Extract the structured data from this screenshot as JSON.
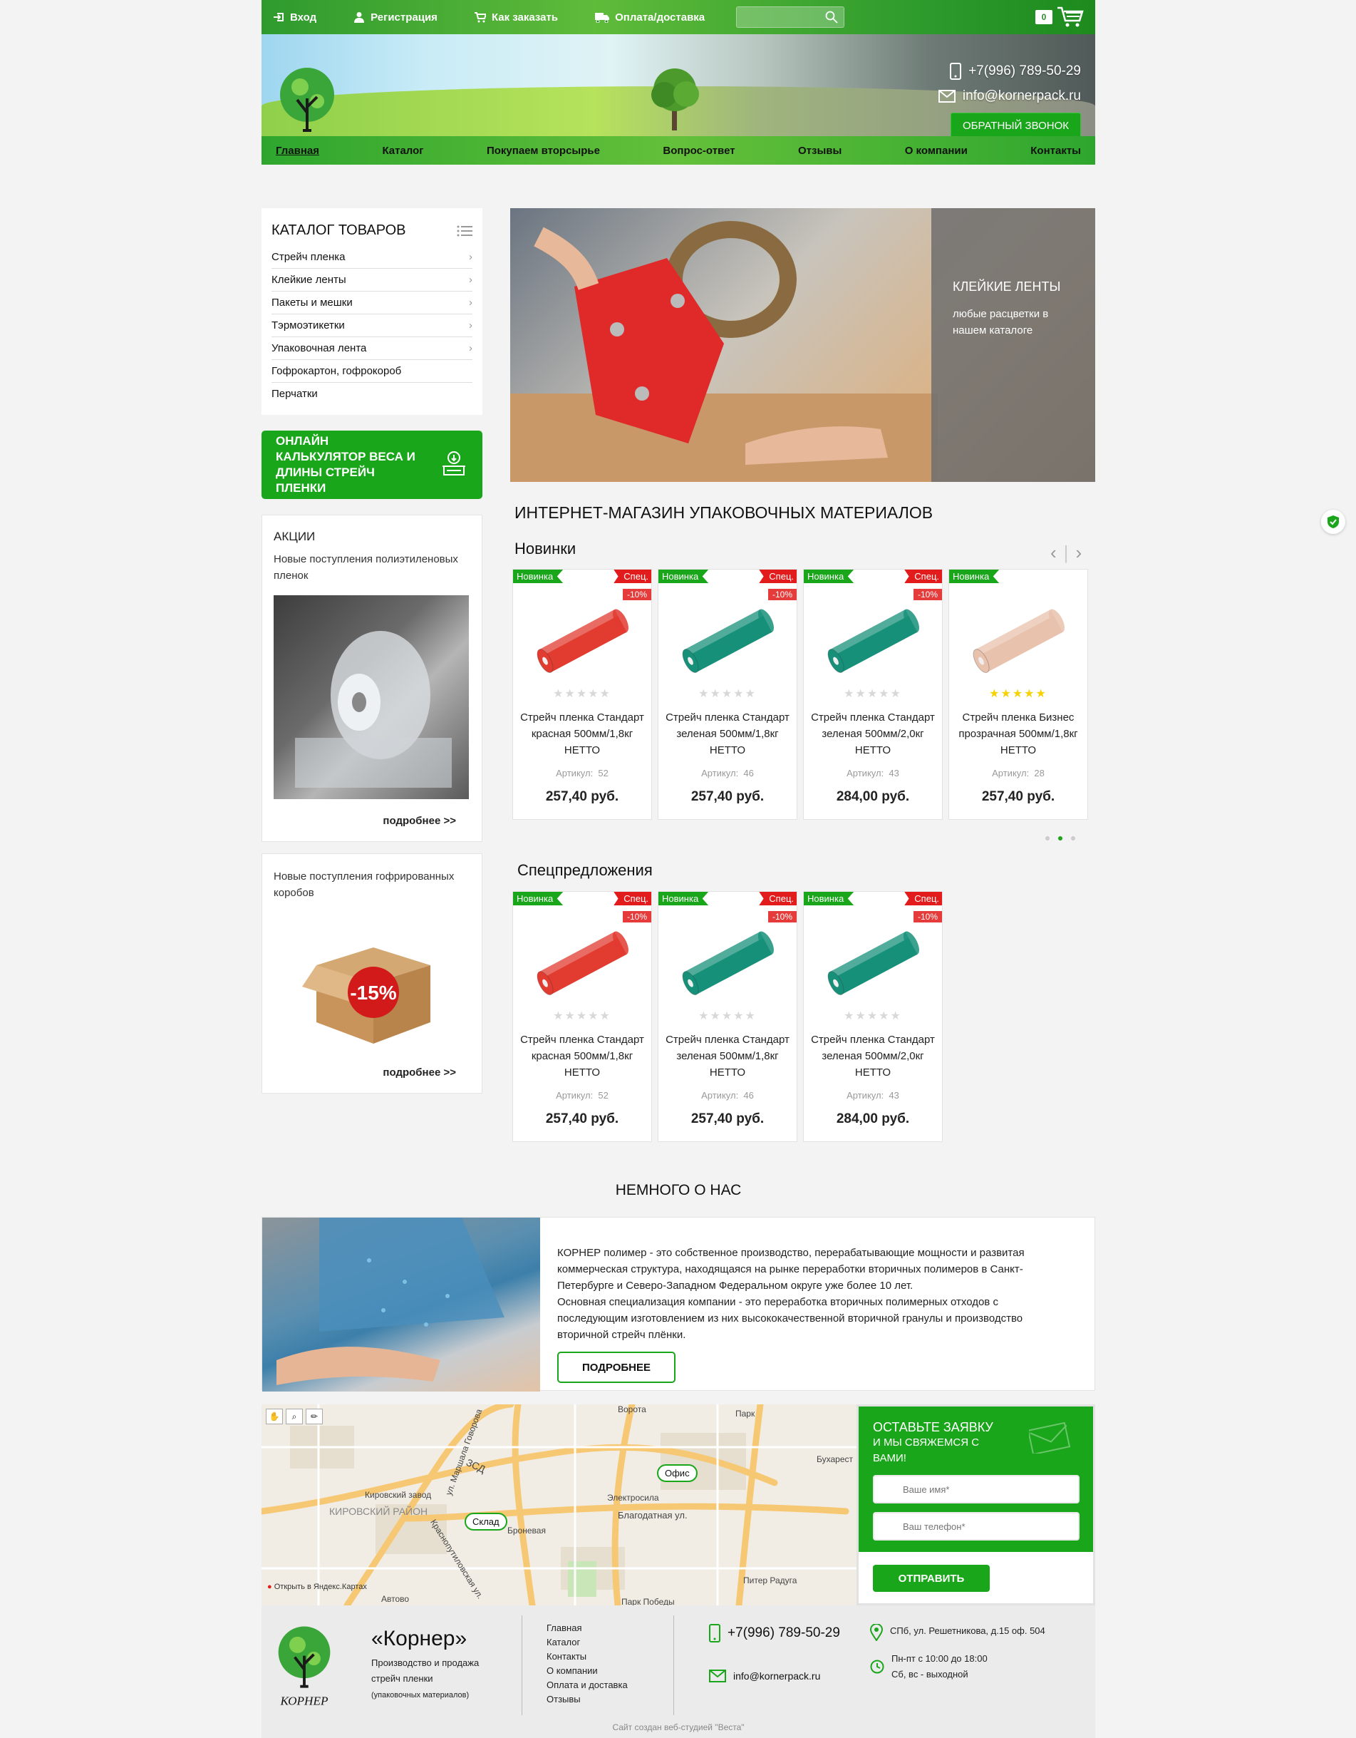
{
  "topbar": {
    "login": "Вход",
    "register": "Регистрация",
    "how_to_order": "Как заказать",
    "payment": "Оплата/доставка",
    "search_placeholder": "",
    "cart_count": "0"
  },
  "header": {
    "logo_text": "КОРНЕР",
    "phone": "+7(996) 789-50-29",
    "email": "info@kornerpack.ru",
    "callback": "ОБРАТНЫЙ ЗВОНОК"
  },
  "nav": [
    "Главная",
    "Каталог",
    "Покупаем вторсырье",
    "Вопрос-ответ",
    "Отзывы",
    "О компании",
    "Контакты"
  ],
  "catalog": {
    "title": "КАТАЛОГ ТОВАРОВ",
    "items": [
      {
        "label": "Стрейч пленка",
        "arrow": true
      },
      {
        "label": "Клейкие ленты",
        "arrow": true
      },
      {
        "label": "Пакеты и мешки",
        "arrow": true
      },
      {
        "label": "Тэрмоэтикетки",
        "arrow": true
      },
      {
        "label": "Упаковочная лента",
        "arrow": true
      },
      {
        "label": "Гофрокартон, гофрокороб",
        "arrow": false
      },
      {
        "label": "Перчатки",
        "arrow": false
      }
    ]
  },
  "calculator": "ОНЛАЙН КАЛЬКУЛЯТОР ВЕСА И ДЛИНЫ СТРЕЙЧ ПЛЕНКИ",
  "promos": [
    {
      "title": "АКЦИИ",
      "text": "Новые поступления полиэтиленовых пленок",
      "more": "подробнее >>"
    },
    {
      "title": "",
      "text": "Новые поступления гофрированных коробов",
      "badge": "-15%",
      "more": "подробнее >>"
    }
  ],
  "banner": {
    "title": "КЛЕЙКИЕ ЛЕНТЫ",
    "text": "любые расцветки в нашем каталоге"
  },
  "main_title": "ИНТЕРНЕТ-МАГАЗИН УПАКОВОЧНЫХ МАТЕРИАЛОВ",
  "new_title": "Новинки",
  "special_title": "Спецпредложения",
  "labels": {
    "new": "Новинка",
    "spec": "Спец.",
    "article": "Артикул:"
  },
  "new_products": [
    {
      "name": "Стрейч пленка Стандарт красная 500мм/1,8кг НЕТТО",
      "article": "52",
      "price": "257,40 руб.",
      "discount": "-10%",
      "spec": true,
      "color": "#e23b30",
      "rating": 0
    },
    {
      "name": "Стрейч пленка Стандарт зеленая 500мм/1,8кг НЕТТО",
      "article": "46",
      "price": "257,40 руб.",
      "discount": "-10%",
      "spec": true,
      "color": "#17907a",
      "rating": 0
    },
    {
      "name": "Стрейч пленка Стандарт зеленая 500мм/2,0кг НЕТТО",
      "article": "43",
      "price": "284,00 руб.",
      "discount": "-10%",
      "spec": true,
      "color": "#17907a",
      "rating": 0
    },
    {
      "name": "Стрейч пленка Бизнес прозрачная 500мм/1,8кг НЕТТО",
      "article": "28",
      "price": "257,40 руб.",
      "discount": "",
      "spec": false,
      "color": "#e9c2ad",
      "rating": 5
    }
  ],
  "special_products": [
    {
      "name": "Стрейч пленка Стандарт красная 500мм/1,8кг НЕТТО",
      "article": "52",
      "price": "257,40 руб.",
      "discount": "-10%",
      "spec": true,
      "color": "#e23b30",
      "rating": 0
    },
    {
      "name": "Стрейч пленка Стандарт зеленая 500мм/1,8кг НЕТТО",
      "article": "46",
      "price": "257,40 руб.",
      "discount": "-10%",
      "spec": true,
      "color": "#17907a",
      "rating": 0
    },
    {
      "name": "Стрейч пленка Стандарт зеленая 500мм/2,0кг НЕТТО",
      "article": "43",
      "price": "284,00 руб.",
      "discount": "-10%",
      "spec": true,
      "color": "#17907a",
      "rating": 0
    }
  ],
  "about": {
    "title": "НЕМНОГО О НАС",
    "text1": "КОРНЕР полимер - это собственное производство, перерабатывающие мощности и развитая коммерческая структура, находящаяся на рынке переработки вторичных полимеров в Санкт-Петербурге и Северо-Западном Федеральном округе уже более 10 лет.",
    "text2": "Основная специализация компании - это переработка вторичных полимерных отходов с последующим изготовлением из них высококачественной вторичной гранулы и производство вторичной стрейч плёнки.",
    "button": "ПОДРОБНЕЕ"
  },
  "map": {
    "office": "Офис",
    "warehouse": "Склад",
    "district": "КИРОВСКИЙ РАЙОН",
    "labels": [
      "Кировский завод",
      "Электросила",
      "Благодатная ул.",
      "Бухарест",
      "Парк",
      "Броневая",
      "Питер Радуга",
      "Автово",
      "Парк Победы",
      "ЗСД",
      "ул. Маршала Говорова",
      "Краснопутиловская ул.",
      "Ворота"
    ],
    "yandex": "Открыть в Яндекс.Картах"
  },
  "form": {
    "title": "ОСТАВЬТЕ ЗАЯВКУ",
    "subtitle": "И МЫ СВЯЖЕМСЯ С ВАМИ!",
    "name_placeholder": "Ваше имя*",
    "phone_placeholder": "Ваш телефон*",
    "submit": "ОТПРАВИТЬ"
  },
  "footer": {
    "brand": "«Корнер»",
    "desc1": "Производство и продажа",
    "desc2": "стрейч пленки",
    "desc3": "(упаковочных материалов)",
    "links": [
      "Главная",
      "Каталог",
      "Контакты",
      "О компании",
      "Оплата и доставка",
      "Отзывы"
    ],
    "phone": "+7(996) 789-50-29",
    "email": "info@kornerpack.ru",
    "address": "СПб, ул. Решетникова, д.15 оф. 504",
    "hours1": "Пн-пт с 10:00 до 18:00",
    "hours2": "Сб, вс - выходной",
    "credit": "Сайт создан веб-студией \"Веста\""
  },
  "colors": {
    "accent": "#1aa61a",
    "spec": "#e21c1c"
  }
}
